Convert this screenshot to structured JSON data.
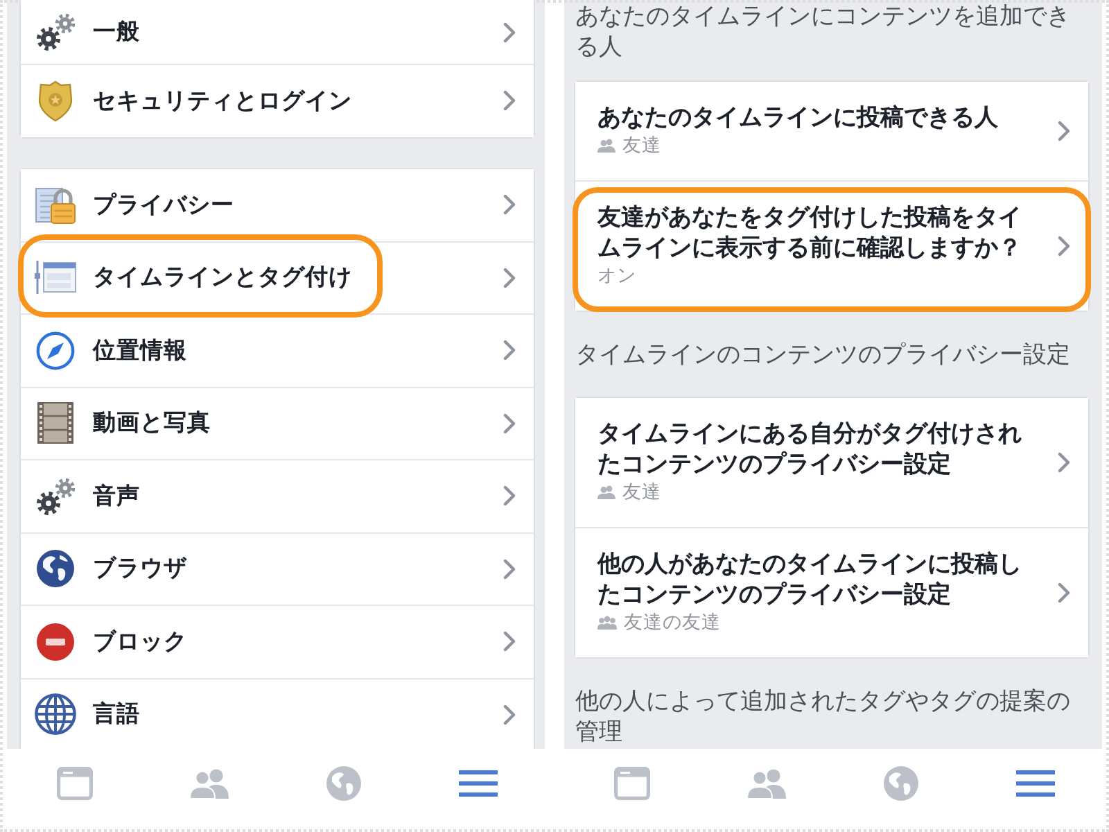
{
  "left_screen": {
    "groups": [
      {
        "items": [
          {
            "label": "一般",
            "highlighted": false
          },
          {
            "label": "セキュリティとログイン",
            "highlighted": false
          }
        ]
      },
      {
        "items": [
          {
            "label": "プライバシー",
            "highlighted": false
          },
          {
            "label": "タイムラインとタグ付け",
            "highlighted": true
          },
          {
            "label": "位置情報",
            "highlighted": false
          },
          {
            "label": "動画と写真",
            "highlighted": false
          },
          {
            "label": "音声",
            "highlighted": false
          },
          {
            "label": "ブラウザ",
            "highlighted": false
          },
          {
            "label": "ブロック",
            "highlighted": false
          },
          {
            "label": "言語",
            "highlighted": false
          }
        ]
      }
    ],
    "tab_bar": [
      {
        "selected": false
      },
      {
        "selected": false
      },
      {
        "selected": false
      },
      {
        "selected": true
      }
    ]
  },
  "right_screen": {
    "sections": [
      {
        "heading": "あなたのタイムラインにコンテンツを追加できる人",
        "items": [
          {
            "title": "あなたのタイムラインに投稿できる人",
            "value": "友達",
            "highlighted": false
          },
          {
            "title": "友達があなたをタグ付けした投稿をタイムラインに表示する前に確認しますか？",
            "value": "オン",
            "highlighted": true
          }
        ]
      },
      {
        "heading": "タイムラインのコンテンツのプライバシー設定",
        "items": [
          {
            "title": "タイムラインにある自分がタグ付けされたコンテンツのプライバシー設定",
            "value": "友達",
            "highlighted": false
          },
          {
            "title": "他の人があなたのタイムラインに投稿したコンテンツのプライバシー設定",
            "value": "友達の友達",
            "highlighted": false
          }
        ]
      },
      {
        "heading": "他の人によって追加されたタグやタグの提案の管理"
      }
    ],
    "tab_bar": [
      {
        "selected": false
      },
      {
        "selected": false
      },
      {
        "selected": false
      },
      {
        "selected": true
      }
    ]
  }
}
